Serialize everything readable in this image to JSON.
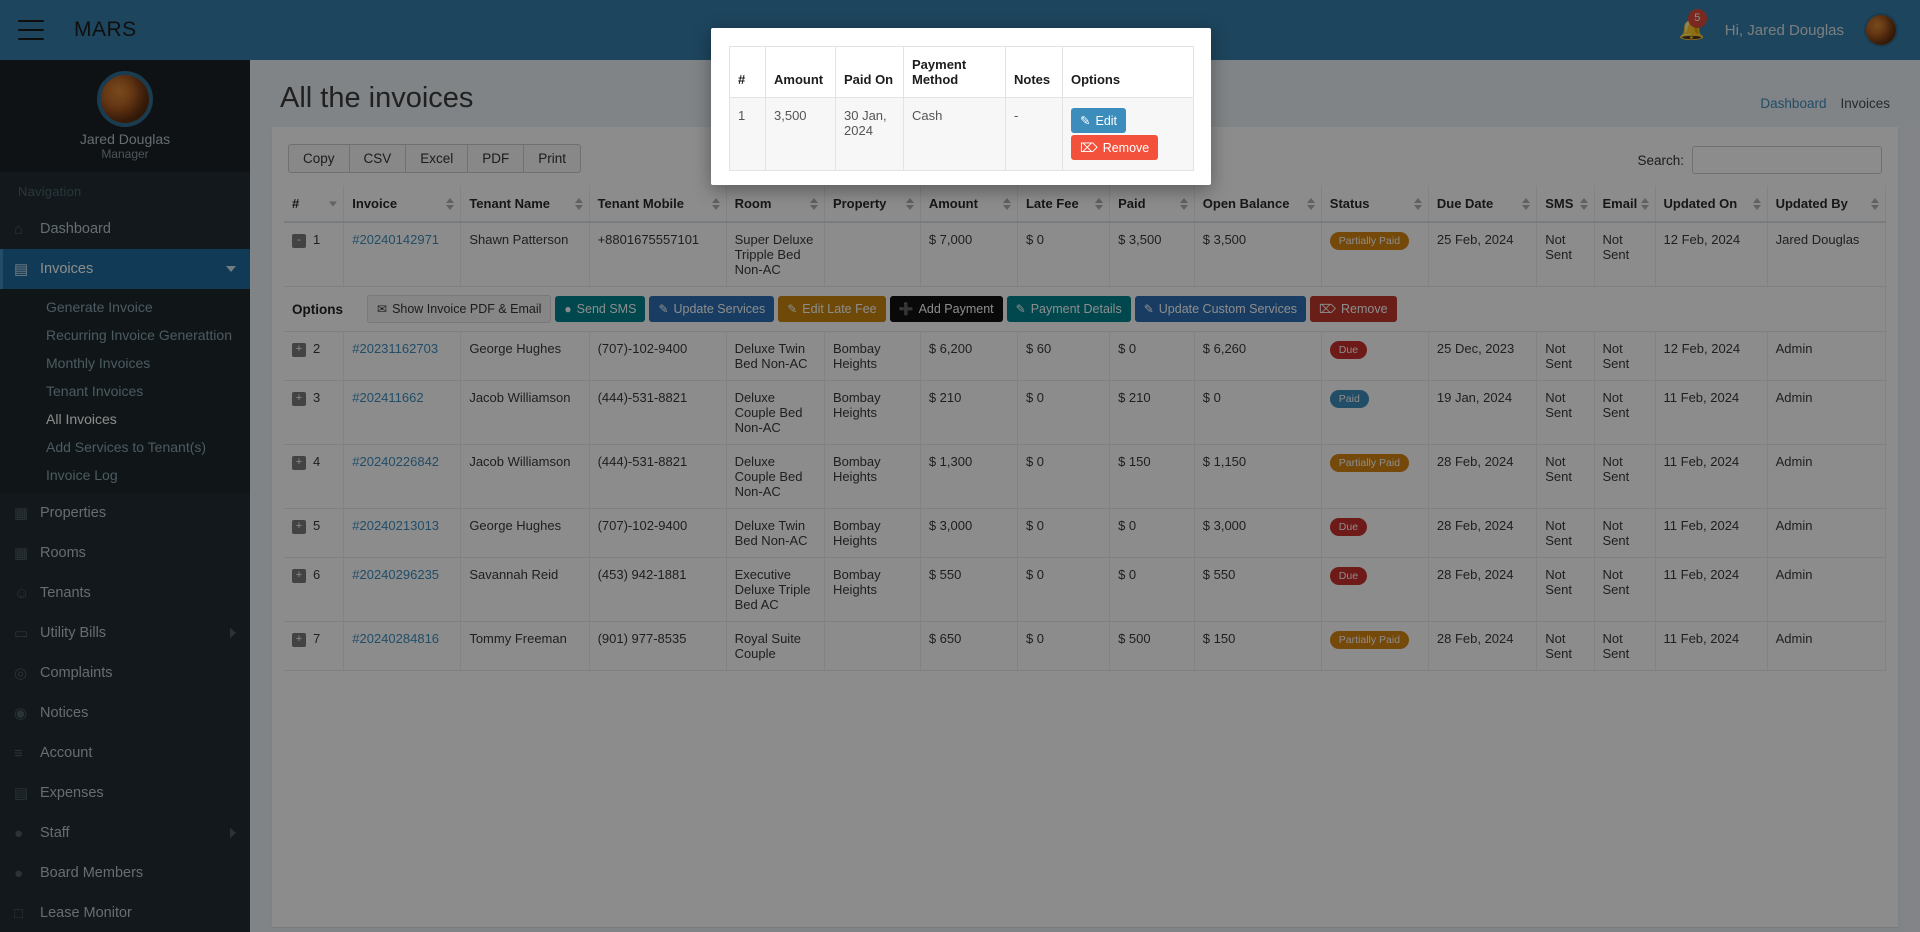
{
  "navbar": {
    "brand": "MARS",
    "menu_icon": "hamburger-icon",
    "notification_icon": "bell-icon",
    "notification_count": "5",
    "greeting": "Hi, Jared Douglas",
    "avatar_icon": "user-avatar"
  },
  "sidebar": {
    "user": {
      "name": "Jared Douglas",
      "role": "Manager"
    },
    "nav_header": "Navigation",
    "items": [
      {
        "label": "Dashboard",
        "icon": "home-icon",
        "active": false,
        "has_caret": false
      },
      {
        "label": "Invoices",
        "icon": "credit-card-icon",
        "active": true,
        "has_caret": "down"
      },
      {
        "label": "Properties",
        "icon": "building-icon",
        "active": false,
        "has_caret": false
      },
      {
        "label": "Rooms",
        "icon": "building-icon",
        "active": false,
        "has_caret": false
      },
      {
        "label": "Tenants",
        "icon": "users-icon",
        "active": false,
        "has_caret": false
      },
      {
        "label": "Utility Bills",
        "icon": "money-icon",
        "active": false,
        "has_caret": "right"
      },
      {
        "label": "Complaints",
        "icon": "lifering-icon",
        "active": false,
        "has_caret": false
      },
      {
        "label": "Notices",
        "icon": "broadcast-icon",
        "active": false,
        "has_caret": false
      },
      {
        "label": "Account",
        "icon": "list-ol-icon",
        "active": false,
        "has_caret": false
      },
      {
        "label": "Expenses",
        "icon": "credit-card-icon",
        "active": false,
        "has_caret": false
      },
      {
        "label": "Staff",
        "icon": "user-icon",
        "active": false,
        "has_caret": "right"
      },
      {
        "label": "Board Members",
        "icon": "user-circle-icon",
        "active": false,
        "has_caret": false
      },
      {
        "label": "Lease Monitor",
        "icon": "square-icon",
        "active": false,
        "has_caret": false
      }
    ],
    "submenu": [
      {
        "label": "Generate Invoice",
        "current": false
      },
      {
        "label": "Recurring Invoice Generattion",
        "current": false
      },
      {
        "label": "Monthly Invoices",
        "current": false
      },
      {
        "label": "Tenant Invoices",
        "current": false
      },
      {
        "label": "All Invoices",
        "current": true
      },
      {
        "label": "Add Services to Tenant(s)",
        "current": false
      },
      {
        "label": "Invoice Log",
        "current": false
      }
    ]
  },
  "page": {
    "title": "All the invoices",
    "breadcrumb": [
      {
        "label": "Dashboard",
        "link": true
      },
      {
        "label": "Invoices",
        "link": false
      }
    ]
  },
  "toolbar": {
    "export_buttons": [
      "Copy",
      "CSV",
      "Excel",
      "PDF",
      "Print"
    ],
    "search_label": "Search:",
    "search_value": "",
    "search_placeholder": ""
  },
  "table": {
    "columns": [
      "#",
      "Invoice",
      "Tenant Name",
      "Tenant Mobile",
      "Room",
      "Property",
      "Amount",
      "Late Fee",
      "Paid",
      "Open Balance",
      "Status",
      "Due Date",
      "SMS",
      "Email",
      "Updated On",
      "Updated By"
    ],
    "rows": [
      {
        "expander": "-",
        "num": "1",
        "invoice": "#20240142971",
        "tenant": "Shawn Patterson",
        "mobile": "+8801675557101",
        "room": "Super Deluxe Tripple Bed Non-AC",
        "property": "",
        "amount": "$ 7,000",
        "late_fee": "$ 0",
        "paid": "$ 3,500",
        "open_balance": "$ 3,500",
        "status": "Partially Paid",
        "status_class": "badge-partial",
        "due_date": "25 Feb, 2024",
        "sms": "Not Sent",
        "email": "Not Sent",
        "updated_on": "12 Feb, 2024",
        "updated_by": "Jared Douglas",
        "expanded": true
      },
      {
        "expander": "+",
        "num": "2",
        "invoice": "#20231162703",
        "tenant": "George Hughes",
        "mobile": "(707)-102-9400",
        "room": "Deluxe Twin Bed Non-AC",
        "property": "Bombay Heights",
        "amount": "$ 6,200",
        "late_fee": "$ 60",
        "paid": "$ 0",
        "open_balance": "$ 6,260",
        "status": "Due",
        "status_class": "badge-due",
        "due_date": "25 Dec, 2023",
        "sms": "Not Sent",
        "email": "Not Sent",
        "updated_on": "12 Feb, 2024",
        "updated_by": "Admin",
        "expanded": false
      },
      {
        "expander": "+",
        "num": "3",
        "invoice": "#202411662",
        "tenant": "Jacob Williamson",
        "mobile": "(444)-531-8821",
        "room": "Deluxe Couple Bed Non-AC",
        "property": "Bombay Heights",
        "amount": "$ 210",
        "late_fee": "$ 0",
        "paid": "$ 210",
        "open_balance": "$ 0",
        "status": "Paid",
        "status_class": "badge-paid",
        "due_date": "19 Jan, 2024",
        "sms": "Not Sent",
        "email": "Not Sent",
        "updated_on": "11 Feb, 2024",
        "updated_by": "Admin",
        "expanded": false
      },
      {
        "expander": "+",
        "num": "4",
        "invoice": "#20240226842",
        "tenant": "Jacob Williamson",
        "mobile": "(444)-531-8821",
        "room": "Deluxe Couple Bed Non-AC",
        "property": "Bombay Heights",
        "amount": "$ 1,300",
        "late_fee": "$ 0",
        "paid": "$ 150",
        "open_balance": "$ 1,150",
        "status": "Partially Paid",
        "status_class": "badge-partial",
        "due_date": "28 Feb, 2024",
        "sms": "Not Sent",
        "email": "Not Sent",
        "updated_on": "11 Feb, 2024",
        "updated_by": "Admin",
        "expanded": false
      },
      {
        "expander": "+",
        "num": "5",
        "invoice": "#20240213013",
        "tenant": "George Hughes",
        "mobile": "(707)-102-9400",
        "room": "Deluxe Twin Bed Non-AC",
        "property": "Bombay Heights",
        "amount": "$ 3,000",
        "late_fee": "$ 0",
        "paid": "$ 0",
        "open_balance": "$ 3,000",
        "status": "Due",
        "status_class": "badge-due",
        "due_date": "28 Feb, 2024",
        "sms": "Not Sent",
        "email": "Not Sent",
        "updated_on": "11 Feb, 2024",
        "updated_by": "Admin",
        "expanded": false
      },
      {
        "expander": "+",
        "num": "6",
        "invoice": "#20240296235",
        "tenant": "Savannah Reid",
        "mobile": "(453) 942-1881",
        "room": "Executive Deluxe Triple Bed AC",
        "property": "Bombay Heights",
        "amount": "$ 550",
        "late_fee": "$ 0",
        "paid": "$ 0",
        "open_balance": "$ 550",
        "status": "Due",
        "status_class": "badge-due",
        "due_date": "28 Feb, 2024",
        "sms": "Not Sent",
        "email": "Not Sent",
        "updated_on": "11 Feb, 2024",
        "updated_by": "Admin",
        "expanded": false
      },
      {
        "expander": "+",
        "num": "7",
        "invoice": "#20240284816",
        "tenant": "Tommy Freeman",
        "mobile": "(901) 977-8535",
        "room": "Royal Suite Couple",
        "property": "",
        "amount": "$ 650",
        "late_fee": "$ 0",
        "paid": "$ 500",
        "open_balance": "$ 150",
        "status": "Partially Paid",
        "status_class": "badge-partial",
        "due_date": "28 Feb, 2024",
        "sms": "Not Sent",
        "email": "Not Sent",
        "updated_on": "11 Feb, 2024",
        "updated_by": "Admin",
        "expanded": false
      }
    ],
    "options_row": {
      "label": "Options",
      "buttons": [
        {
          "label": "Show Invoice PDF & Email",
          "icon": "envelope-icon",
          "style": "opt-default"
        },
        {
          "label": "Send SMS",
          "icon": "comment-icon",
          "style": "opt-teal"
        },
        {
          "label": "Update Services",
          "icon": "edit-icon",
          "style": "opt-blue"
        },
        {
          "label": "Edit Late Fee",
          "icon": "edit-icon",
          "style": "opt-orange"
        },
        {
          "label": "Add Payment",
          "icon": "plus-icon",
          "style": "opt-black"
        },
        {
          "label": "Payment Details",
          "icon": "edit-icon",
          "style": "opt-teal2"
        },
        {
          "label": "Update Custom Services",
          "icon": "edit-icon",
          "style": "opt-blue2"
        },
        {
          "label": "Remove",
          "icon": "trash-icon",
          "style": "opt-red"
        }
      ]
    }
  },
  "modal": {
    "columns": [
      "#",
      "Amount",
      "Paid On",
      "Payment Method",
      "Notes",
      "Options"
    ],
    "rows": [
      {
        "num": "1",
        "amount": "3,500",
        "paid_on": "30 Jan, 2024",
        "payment_method": "Cash",
        "notes": "-",
        "edit_label": "Edit",
        "remove_label": "Remove"
      }
    ]
  },
  "colors": {
    "accent": "#3c8dbc",
    "sidebar_bg": "#222d32",
    "partial": "#d58512",
    "due": "#c9302c",
    "paid": "#3c8dbc",
    "remove": "#f4513c"
  }
}
